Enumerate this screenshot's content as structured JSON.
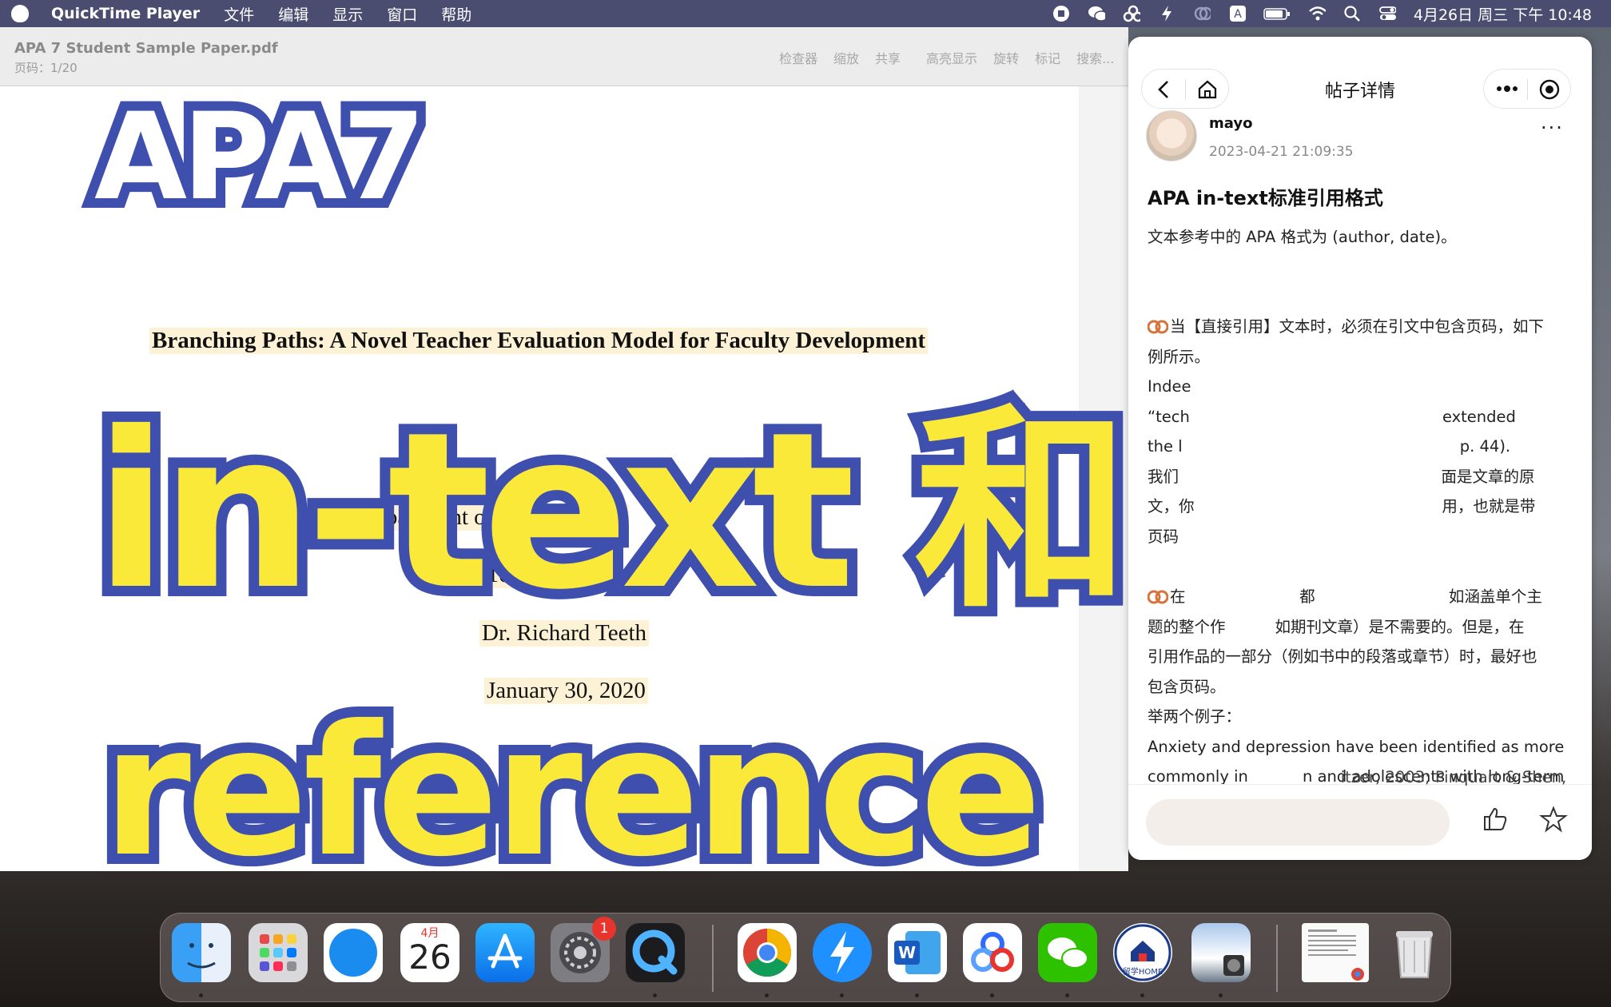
{
  "menubar": {
    "app": "QuickTime Player",
    "menus": [
      "文件",
      "编辑",
      "显示",
      "窗口",
      "帮助"
    ],
    "status_icons": [
      "stop-record-icon",
      "wechat-icon",
      "baidu-netdisk-icon",
      "flash-icon",
      "sync-icon",
      "input-method-icon",
      "battery-icon",
      "wifi-icon",
      "spotlight-icon",
      "control-center-icon"
    ],
    "input_method": "A",
    "clock": "4月26日 周三 下午 10:48"
  },
  "preview": {
    "title": "APA 7 Student Sample Paper.pdf",
    "page": "页码：1/20",
    "tools": [
      "检查器",
      "缩放",
      "共享",
      "高亮显示",
      "旋转",
      "标记",
      "搜索..."
    ],
    "doc": {
      "title": "Branching Paths: A Novel Teacher Evaluation Model for Faculty Development",
      "department": "Department of E",
      "department_tail": "Pu",
      "course": "ENGL 101",
      "instructor": "Dr. Richard Teeth",
      "date": "January 30, 2020"
    }
  },
  "wechat": {
    "header_title": "帖子详情",
    "author": "mayo",
    "post_date": "2023-04-21 21:09:35",
    "more": "···",
    "post_title": "APA in-text标准引用格式",
    "lines": [
      "文本参考中的 APA 格式为 (author, date)。",
      "",
      "当【直接引用】文本时，必须在引文中包含页码，如下",
      "例所示。",
      "Indee",
      "“tech                                                   extended",
      "the l                                                        p. 44).",
      "我们                                                     面是文章的原",
      "文，你                                                  用，也就是带",
      "页码",
      "",
      "在                       都                           如涵盖单个主",
      "题的整个作          如期刊文章）是不需要的。但是，在",
      "引用作品的一部分（例如书中的段落或章节）时，最好也",
      "包含页码。",
      "举两个例子：",
      "Anxiety and depression have been identified as more",
      "commonly in           n and adolescents with long-term",
      "                                       itzer, 2003; Pinquart & Shen,"
    ]
  },
  "overlay": {
    "line1": "APA7",
    "line2": "in-text 和",
    "line3": "reference"
  },
  "dock": {
    "calendar_month": "4月",
    "calendar_day": "26",
    "settings_badge": "1",
    "home_app_label": "留学HOME"
  },
  "colors": {
    "overlay_fill": "#fbe93a",
    "overlay_stroke": "#3f4fae",
    "highlight": "#fdf1d6"
  }
}
